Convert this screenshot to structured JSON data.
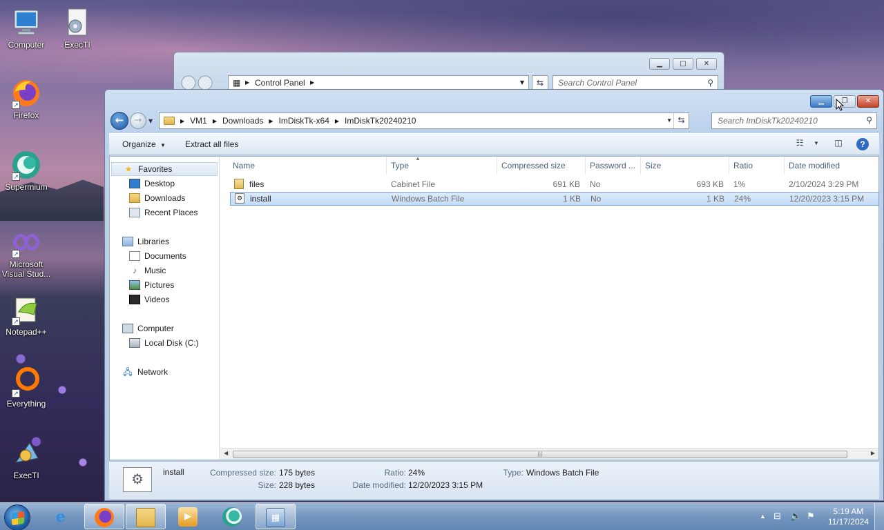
{
  "desktop": {
    "icons": [
      {
        "label": "Computer",
        "icon": "computer-icon"
      },
      {
        "label": "ExecTI",
        "icon": "execti-icon"
      },
      {
        "label": "Firefox",
        "icon": "firefox-icon"
      },
      {
        "label": "Supermium",
        "icon": "supermium-icon"
      },
      {
        "label": "Microsoft Visual Stud...",
        "icon": "visual-studio-icon"
      },
      {
        "label": "Notepad++",
        "icon": "notepadpp-icon"
      },
      {
        "label": "Everything",
        "icon": "everything-icon"
      },
      {
        "label": "ExecTI",
        "icon": "execti-icon"
      }
    ]
  },
  "back_window": {
    "address": "Control Panel",
    "search_placeholder": "Search Control Panel"
  },
  "explorer": {
    "breadcrumbs": [
      "VM1",
      "Downloads",
      "ImDiskTk-x64",
      "ImDiskTk20240210"
    ],
    "search_placeholder": "Search ImDiskTk20240210",
    "toolbar": {
      "organize": "Organize",
      "extract": "Extract all files"
    },
    "nav": {
      "favorites": "Favorites",
      "desktop": "Desktop",
      "downloads": "Downloads",
      "recent": "Recent Places",
      "libraries": "Libraries",
      "documents": "Documents",
      "music": "Music",
      "pictures": "Pictures",
      "videos": "Videos",
      "computer": "Computer",
      "local_disk": "Local Disk (C:)",
      "network": "Network"
    },
    "columns": [
      "Name",
      "Type",
      "Compressed size",
      "Password ...",
      "Size",
      "Ratio",
      "Date modified"
    ],
    "files": [
      {
        "name": "files",
        "type": "Cabinet File",
        "compressed": "691 KB",
        "password": "No",
        "size": "693 KB",
        "ratio": "1%",
        "modified": "2/10/2024 3:29 PM"
      },
      {
        "name": "install",
        "type": "Windows Batch File",
        "compressed": "1 KB",
        "password": "No",
        "size": "1 KB",
        "ratio": "24%",
        "modified": "12/20/2023 3:15 PM"
      }
    ],
    "details": {
      "name": "install",
      "compressed_label": "Compressed size:",
      "compressed_value": "175 bytes",
      "size_label": "Size:",
      "size_value": "228 bytes",
      "ratio_label": "Ratio:",
      "ratio_value": "24%",
      "modified_label": "Date modified:",
      "modified_value": "12/20/2023 3:15 PM",
      "type_label": "Type:",
      "type_value": "Windows Batch File"
    }
  },
  "taskbar": {
    "time": "5:19 AM",
    "date": "11/17/2024"
  }
}
